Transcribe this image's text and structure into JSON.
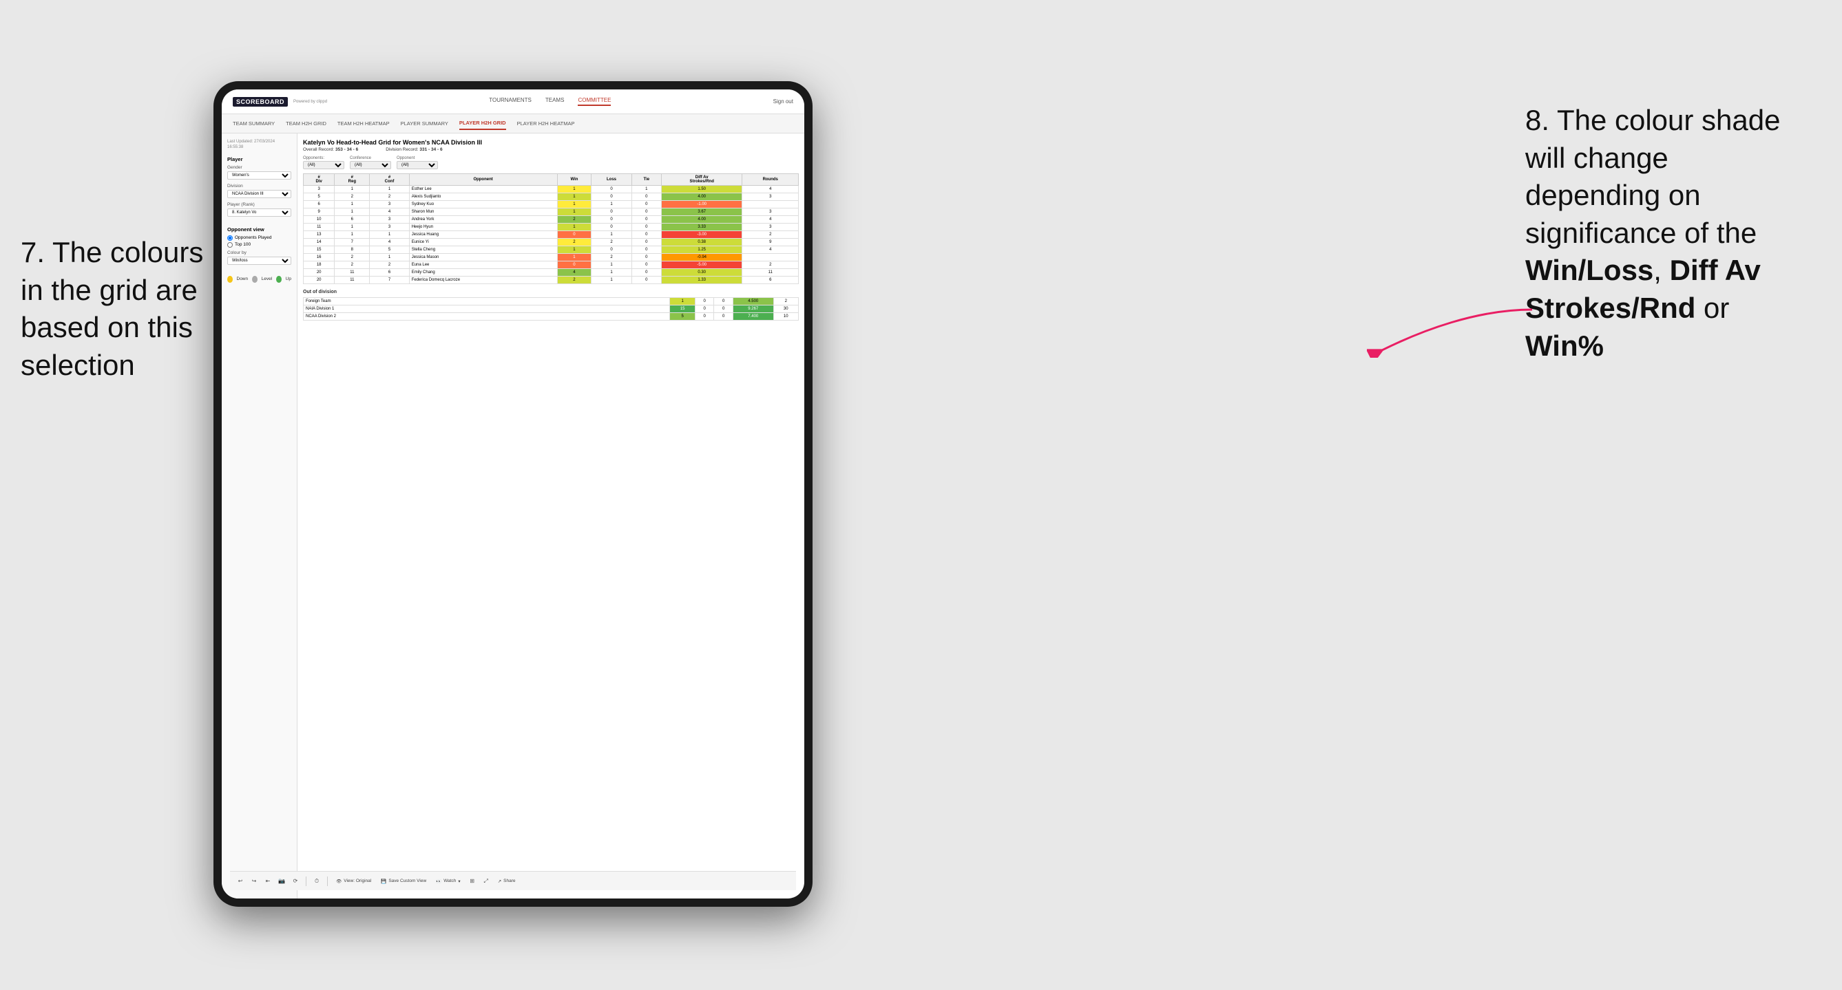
{
  "annotations": {
    "left_title": "7. The colours in the grid are based on this selection",
    "right_title": "8. The colour shade will change depending on significance of the",
    "right_bold1": "Win/Loss",
    "right_comma1": ", ",
    "right_bold2": "Diff Av Strokes/Rnd",
    "right_or": " or",
    "right_bold3": "Win%"
  },
  "nav": {
    "brand": "SCOREBOARD",
    "brand_sub": "Powered by clippd",
    "links": [
      "TOURNAMENTS",
      "TEAMS",
      "COMMITTEE"
    ],
    "active_link": "COMMITTEE",
    "sign_in": "Sign out"
  },
  "sub_nav": {
    "links": [
      "TEAM SUMMARY",
      "TEAM H2H GRID",
      "TEAM H2H HEATMAP",
      "PLAYER SUMMARY",
      "PLAYER H2H GRID",
      "PLAYER H2H HEATMAP"
    ],
    "active": "PLAYER H2H GRID"
  },
  "sidebar": {
    "timestamp_label": "Last Updated: 27/03/2024",
    "timestamp_time": "16:55:38",
    "player_section": "Player",
    "gender_label": "Gender",
    "gender_value": "Women's",
    "division_label": "Division",
    "division_value": "NCAA Division III",
    "player_rank_label": "Player (Rank)",
    "player_rank_value": "8. Katelyn Vo",
    "opponent_view_label": "Opponent view",
    "radio_opponents": "Opponents Played",
    "radio_top100": "Top 100",
    "colour_by_label": "Colour by",
    "colour_by_value": "Win/loss",
    "legend_down": "Down",
    "legend_level": "Level",
    "legend_up": "Up",
    "colours": {
      "down": "#f5c518",
      "level": "#aaaaaa",
      "up": "#4caf50"
    }
  },
  "grid": {
    "title": "Katelyn Vo Head-to-Head Grid for Women's NCAA Division III",
    "overall_record_label": "Overall Record:",
    "overall_record": "353 - 34 - 6",
    "division_record_label": "Division Record:",
    "division_record": "331 - 34 - 6",
    "filters": {
      "opponents_label": "Opponents:",
      "opponents_value": "(All)",
      "conference_label": "Conference",
      "conference_value": "(All)",
      "opponent_label": "Opponent",
      "opponent_value": "(All)"
    },
    "col_headers": [
      "#\nDiv",
      "#\nReg",
      "#\nConf",
      "Opponent",
      "Win",
      "Loss",
      "Tie",
      "Diff Av\nStrokes/Rnd",
      "Rounds"
    ],
    "rows": [
      {
        "div": "3",
        "reg": "1",
        "conf": "1",
        "opponent": "Esther Lee",
        "win": 1,
        "loss": 0,
        "tie": 1,
        "diff": "1.50",
        "rounds": "4",
        "win_color": "cell-yellow",
        "diff_color": "cell-green-light"
      },
      {
        "div": "5",
        "reg": "2",
        "conf": "2",
        "opponent": "Alexis Sudjianto",
        "win": 1,
        "loss": 0,
        "tie": 0,
        "diff": "4.00",
        "rounds": "3",
        "win_color": "cell-green-light",
        "diff_color": "cell-green-mid"
      },
      {
        "div": "6",
        "reg": "1",
        "conf": "3",
        "opponent": "Sydney Kuo",
        "win": 1,
        "loss": 1,
        "tie": 0,
        "diff": "-1.00",
        "rounds": "",
        "win_color": "cell-yellow",
        "diff_color": "cell-red-light"
      },
      {
        "div": "9",
        "reg": "1",
        "conf": "4",
        "opponent": "Sharon Mun",
        "win": 1,
        "loss": 0,
        "tie": 0,
        "diff": "3.67",
        "rounds": "3",
        "win_color": "cell-green-light",
        "diff_color": "cell-green-mid"
      },
      {
        "div": "10",
        "reg": "6",
        "conf": "3",
        "opponent": "Andrea York",
        "win": 2,
        "loss": 0,
        "tie": 0,
        "diff": "4.00",
        "rounds": "4",
        "win_color": "cell-green-mid",
        "diff_color": "cell-green-mid"
      },
      {
        "div": "11",
        "reg": "1",
        "conf": "3",
        "opponent": "Heejo Hyun",
        "win": 1,
        "loss": 0,
        "tie": 0,
        "diff": "3.33",
        "rounds": "3",
        "win_color": "cell-green-light",
        "diff_color": "cell-green-mid"
      },
      {
        "div": "13",
        "reg": "1",
        "conf": "1",
        "opponent": "Jessica Huang",
        "win": 0,
        "loss": 1,
        "tie": 0,
        "diff": "-3.00",
        "rounds": "2",
        "win_color": "cell-red-light",
        "diff_color": "cell-red"
      },
      {
        "div": "14",
        "reg": "7",
        "conf": "4",
        "opponent": "Eunice Yi",
        "win": 2,
        "loss": 2,
        "tie": 0,
        "diff": "0.38",
        "rounds": "9",
        "win_color": "cell-yellow",
        "diff_color": "cell-green-light"
      },
      {
        "div": "15",
        "reg": "8",
        "conf": "5",
        "opponent": "Stella Cheng",
        "win": 1,
        "loss": 0,
        "tie": 0,
        "diff": "1.25",
        "rounds": "4",
        "win_color": "cell-green-light",
        "diff_color": "cell-green-light"
      },
      {
        "div": "16",
        "reg": "2",
        "conf": "1",
        "opponent": "Jessica Mason",
        "win": 1,
        "loss": 2,
        "tie": 0,
        "diff": "-0.94",
        "rounds": "",
        "win_color": "cell-red-light",
        "diff_color": "cell-orange"
      },
      {
        "div": "18",
        "reg": "2",
        "conf": "2",
        "opponent": "Euna Lee",
        "win": 0,
        "loss": 1,
        "tie": 0,
        "diff": "-5.00",
        "rounds": "2",
        "win_color": "cell-red-light",
        "diff_color": "cell-red"
      },
      {
        "div": "20",
        "reg": "11",
        "conf": "6",
        "opponent": "Emily Chang",
        "win": 4,
        "loss": 1,
        "tie": 0,
        "diff": "0.30",
        "rounds": "11",
        "win_color": "cell-green-mid",
        "diff_color": "cell-green-light"
      },
      {
        "div": "20",
        "reg": "11",
        "conf": "7",
        "opponent": "Federica Domecq Lacroze",
        "win": 2,
        "loss": 1,
        "tie": 0,
        "diff": "1.33",
        "rounds": "6",
        "win_color": "cell-green-light",
        "diff_color": "cell-green-light"
      }
    ],
    "out_of_division_label": "Out of division",
    "out_of_division_rows": [
      {
        "label": "Foreign Team",
        "win": 1,
        "loss": 0,
        "tie": 0,
        "diff": "4.500",
        "rounds": "2",
        "win_color": "cell-green-light",
        "diff_color": "cell-green-mid"
      },
      {
        "label": "NAIA Division 1",
        "win": 15,
        "loss": 0,
        "tie": 0,
        "diff": "9.267",
        "rounds": "30",
        "win_color": "cell-green-dark",
        "diff_color": "cell-green-dark"
      },
      {
        "label": "NCAA Division 2",
        "win": 5,
        "loss": 0,
        "tie": 0,
        "diff": "7.400",
        "rounds": "10",
        "win_color": "cell-green-mid",
        "diff_color": "cell-green-dark"
      }
    ]
  },
  "toolbar": {
    "undo": "↩",
    "redo": "↪",
    "view_original": "View: Original",
    "save_custom": "Save Custom View",
    "watch": "Watch",
    "share": "Share"
  }
}
